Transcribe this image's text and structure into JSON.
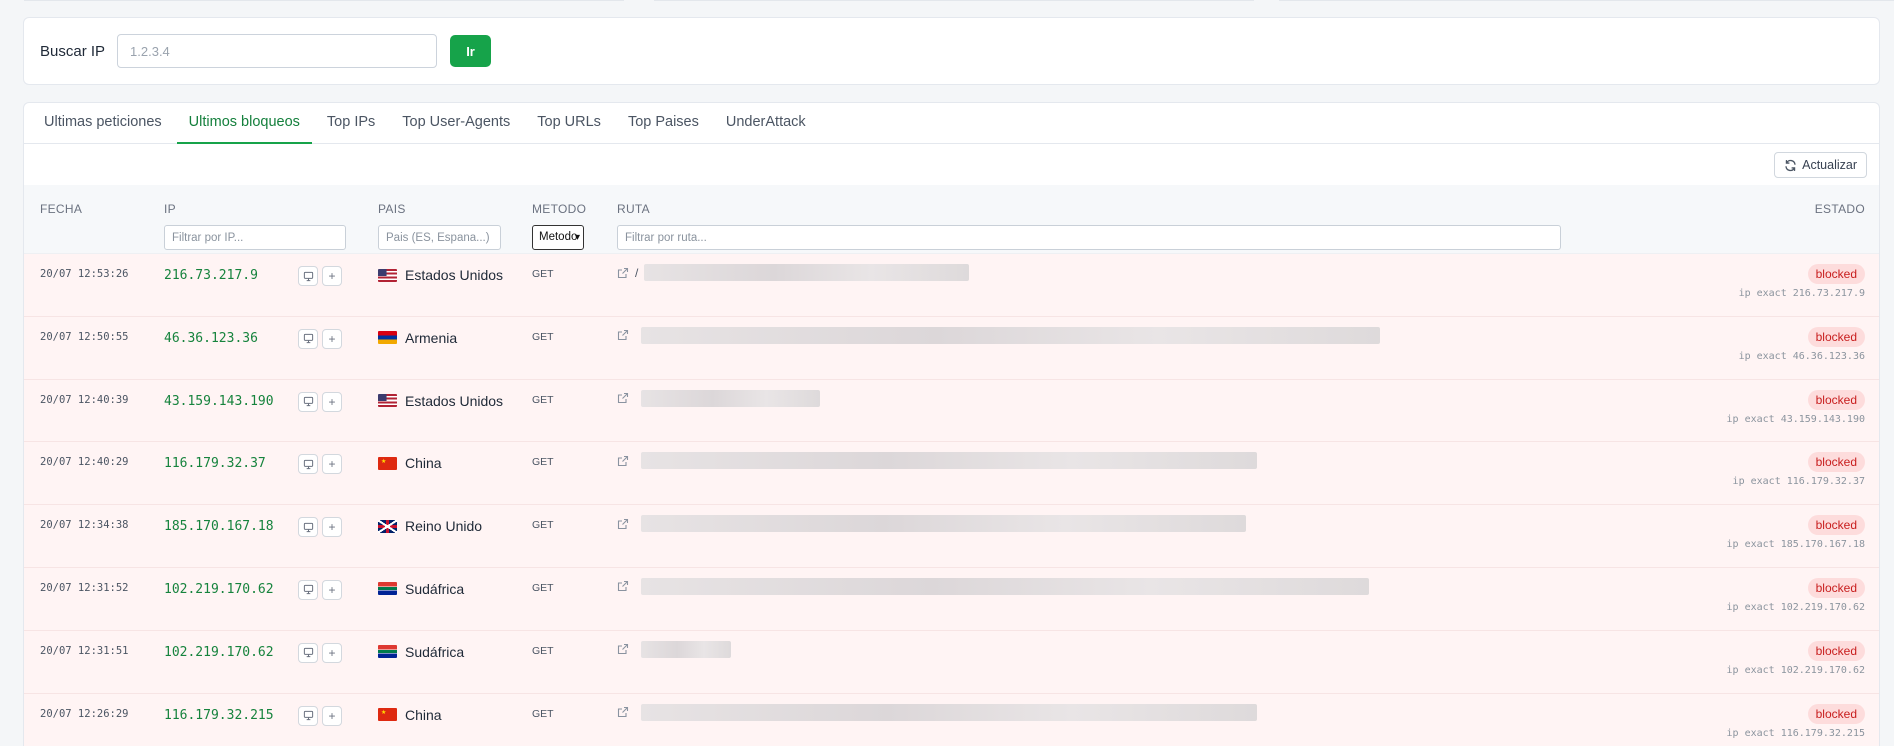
{
  "search": {
    "label": "Buscar IP",
    "placeholder": "1.2.3.4",
    "button": "Ir"
  },
  "tabs": [
    {
      "label": "Ultimas peticiones",
      "active": false
    },
    {
      "label": "Ultimos bloqueos",
      "active": true
    },
    {
      "label": "Top IPs",
      "active": false
    },
    {
      "label": "Top User-Agents",
      "active": false
    },
    {
      "label": "Top URLs",
      "active": false
    },
    {
      "label": "Top Paises",
      "active": false
    },
    {
      "label": "UnderAttack",
      "active": false
    }
  ],
  "toolbar": {
    "refresh_label": "Actualizar",
    "refresh_icon": "refresh-icon"
  },
  "table": {
    "headers": {
      "fecha": "FECHA",
      "ip": "IP",
      "pais": "PAIS",
      "metodo": "METODO",
      "ruta": "RUTA",
      "estado": "ESTADO"
    },
    "filters": {
      "ip_placeholder": "Filtrar por IP...",
      "pais_placeholder": "Pais (ES, Espana...)",
      "metodo_value": "Metodo",
      "ruta_placeholder": "Filtrar por ruta..."
    },
    "rows": [
      {
        "date": "20/07 12:53:26",
        "ip": "216.73.217.9",
        "country": "Estados Unidos",
        "flag": "us",
        "method": "GET",
        "route_prefix": "/",
        "route_blur_fraction": 0.29,
        "status": "blocked",
        "rule": "ip exact 216.73.217.9"
      },
      {
        "date": "20/07 12:50:55",
        "ip": "46.36.123.36",
        "country": "Armenia",
        "flag": "am",
        "method": "GET",
        "route_prefix": "",
        "route_blur_fraction": 0.66,
        "status": "blocked",
        "rule": "ip exact 46.36.123.36"
      },
      {
        "date": "20/07 12:40:39",
        "ip": "43.159.143.190",
        "country": "Estados Unidos",
        "flag": "us",
        "method": "GET",
        "route_prefix": "",
        "route_blur_fraction": 0.16,
        "status": "blocked",
        "rule": "ip exact 43.159.143.190"
      },
      {
        "date": "20/07 12:40:29",
        "ip": "116.179.32.37",
        "country": "China",
        "flag": "cn",
        "method": "GET",
        "route_prefix": "",
        "route_blur_fraction": 0.55,
        "status": "blocked",
        "rule": "ip exact 116.179.32.37"
      },
      {
        "date": "20/07 12:34:38",
        "ip": "185.170.167.18",
        "country": "Reino Unido",
        "flag": "gb",
        "method": "GET",
        "route_prefix": "",
        "route_blur_fraction": 0.54,
        "status": "blocked",
        "rule": "ip exact 185.170.167.18"
      },
      {
        "date": "20/07 12:31:52",
        "ip": "102.219.170.62",
        "country": "Sudáfrica",
        "flag": "za",
        "method": "GET",
        "route_prefix": "",
        "route_blur_fraction": 0.65,
        "status": "blocked",
        "rule": "ip exact 102.219.170.62"
      },
      {
        "date": "20/07 12:31:51",
        "ip": "102.219.170.62",
        "country": "Sudáfrica",
        "flag": "za",
        "method": "GET",
        "route_prefix": "",
        "route_blur_fraction": 0.08,
        "status": "blocked",
        "rule": "ip exact 102.219.170.62"
      },
      {
        "date": "20/07 12:26:29",
        "ip": "116.179.32.215",
        "country": "China",
        "flag": "cn",
        "method": "GET",
        "route_prefix": "",
        "route_blur_fraction": 0.55,
        "status": "blocked",
        "rule": "ip exact 116.179.32.215"
      }
    ]
  },
  "colors": {
    "accent": "#16a34a",
    "blocked_bg": "#fddcdc",
    "blocked_text": "#c81e1e",
    "row_bg": "#fff4f4"
  }
}
